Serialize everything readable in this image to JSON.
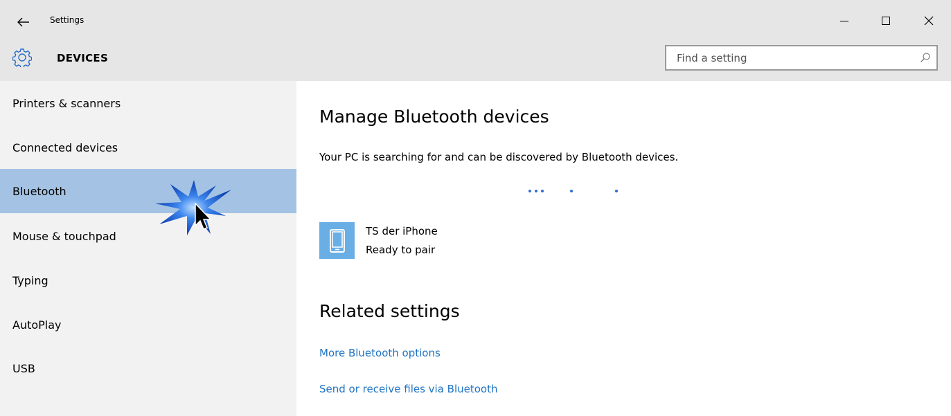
{
  "window": {
    "app_title": "Settings",
    "back_icon": "back-arrow-icon",
    "controls": [
      "minimize-icon",
      "maximize-icon",
      "close-icon"
    ]
  },
  "header": {
    "icon": "gear-icon",
    "title": "DEVICES",
    "search_placeholder": "Find a setting",
    "search_icon": "search-icon"
  },
  "sidebar": {
    "items": [
      {
        "label": "Printers & scanners"
      },
      {
        "label": "Connected devices"
      },
      {
        "label": "Bluetooth",
        "selected": true
      },
      {
        "label": "Mouse & touchpad"
      },
      {
        "label": "Typing"
      },
      {
        "label": "AutoPlay"
      },
      {
        "label": "USB"
      }
    ]
  },
  "main": {
    "title": "Manage Bluetooth devices",
    "description": "Your PC is searching for and can be discovered by Bluetooth devices.",
    "devices": [
      {
        "name": "TS der iPhone",
        "status": "Ready to pair",
        "icon": "phone-icon"
      }
    ],
    "related_title": "Related settings",
    "links": [
      {
        "label": "More Bluetooth options"
      },
      {
        "label": "Send or receive files via Bluetooth"
      }
    ]
  },
  "colors": {
    "chrome_bg": "#e6e6e6",
    "sidebar_bg": "#f2f2f2",
    "selected_bg": "#a4c3e4",
    "accent": "#1f73c3",
    "device_tile": "#6aaee6"
  }
}
